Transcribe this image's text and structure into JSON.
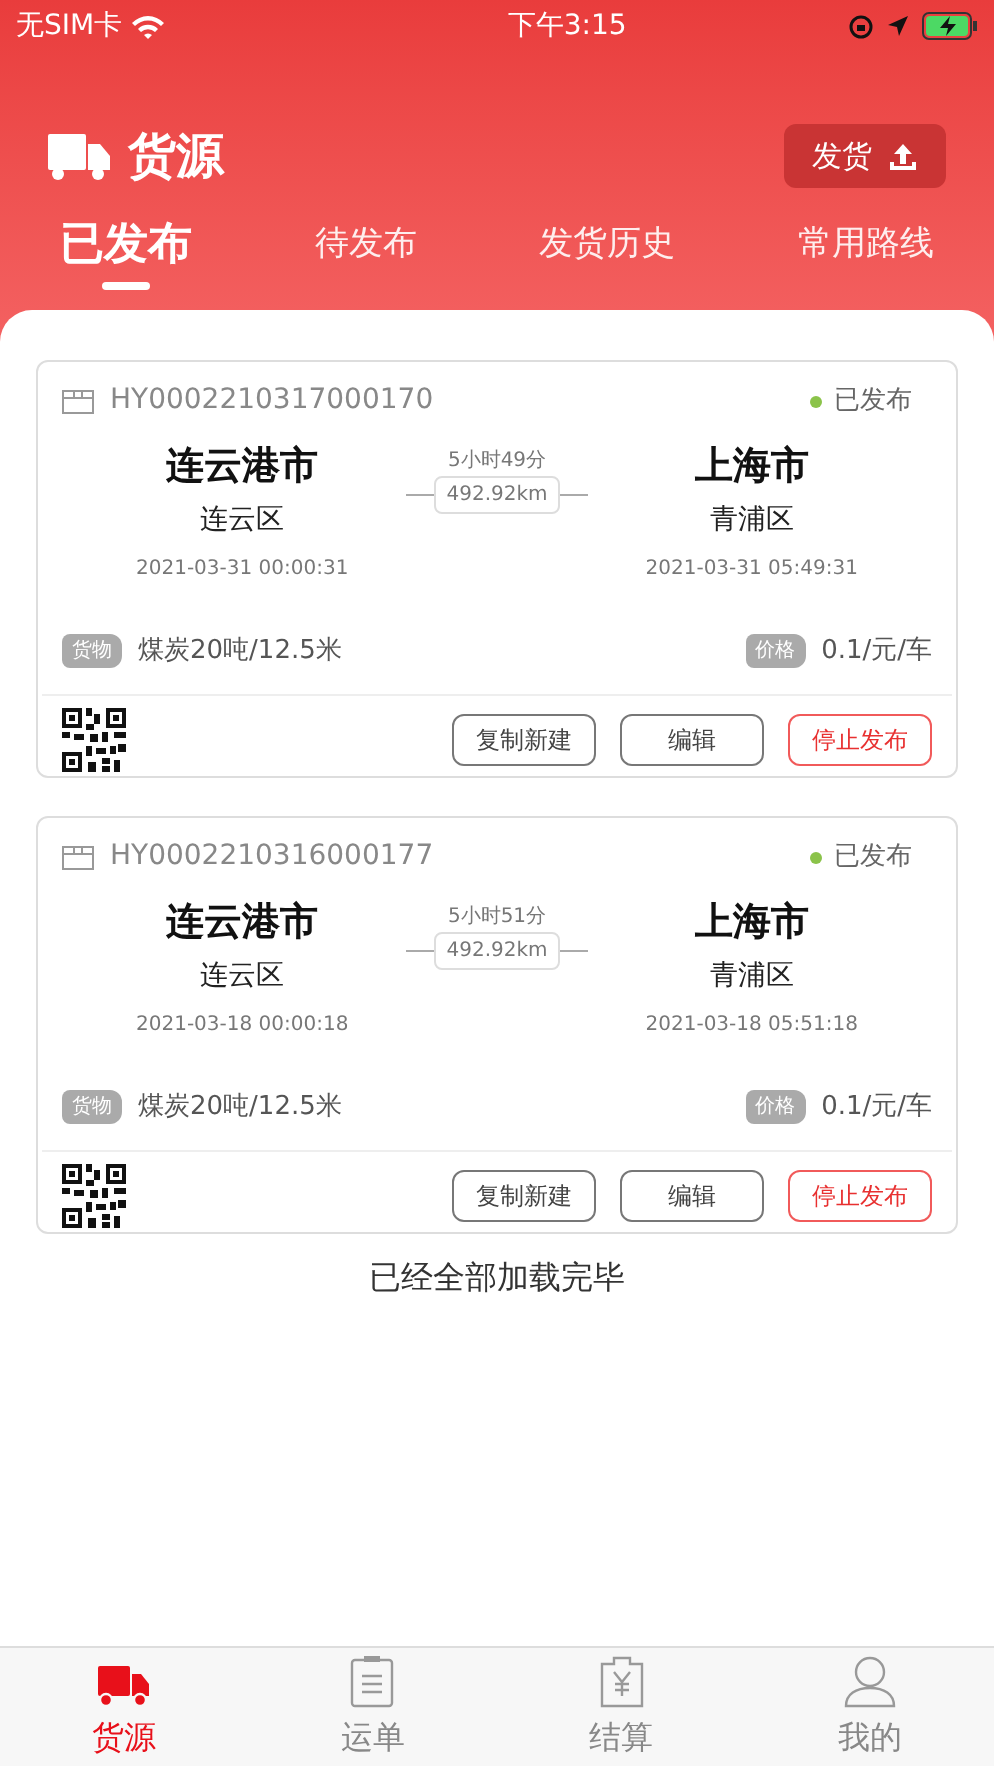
{
  "status_bar": {
    "carrier": "无SIM卡",
    "time": "下午3:15"
  },
  "header": {
    "title": "货源",
    "action_button": "发货"
  },
  "tabs": [
    {
      "label": "已发布",
      "selected": true
    },
    {
      "label": "待发布",
      "selected": false
    },
    {
      "label": "发货历史",
      "selected": false
    },
    {
      "label": "常用路线",
      "selected": false
    }
  ],
  "orders": [
    {
      "id": "HY0002210317000170",
      "status": "已发布",
      "color": "#8bc34a",
      "from": {
        "city": "连云港市",
        "district": "连云区",
        "time": "2021-03-31 00:00:31"
      },
      "to": {
        "city": "上海市",
        "district": "青浦区",
        "time": "2021-03-31 05:49:31"
      },
      "duration": "5小时49分",
      "distance": "492.92km",
      "goods_tag": "货物",
      "goods": "煤炭20吨/12.5米",
      "price_tag": "价格",
      "price": "0.1/元/车",
      "buttons": [
        {
          "label": "复制新建",
          "kind": "plain"
        },
        {
          "label": "编辑",
          "kind": "plain"
        },
        {
          "label": "停止发布",
          "kind": "danger"
        }
      ]
    },
    {
      "id": "HY0002210316000177",
      "status": "已发布",
      "color": "#8bc34a",
      "from": {
        "city": "连云港市",
        "district": "连云区",
        "time": "2021-03-18 00:00:18"
      },
      "to": {
        "city": "上海市",
        "district": "青浦区",
        "time": "2021-03-18 05:51:18"
      },
      "duration": "5小时51分",
      "distance": "492.92km",
      "goods_tag": "货物",
      "goods": "煤炭20吨/12.5米",
      "price_tag": "价格",
      "price": "0.1/元/车",
      "buttons": [
        {
          "label": "复制新建",
          "kind": "plain"
        },
        {
          "label": "编辑",
          "kind": "plain"
        },
        {
          "label": "停止发布",
          "kind": "danger"
        }
      ]
    }
  ],
  "end_message": "已经全部加载完毕",
  "bottom_tabs": [
    {
      "label": "货源",
      "kind": "truck",
      "selected": true
    },
    {
      "label": "运单",
      "kind": "clipboard",
      "selected": false
    },
    {
      "label": "结算",
      "kind": "bill",
      "selected": false
    },
    {
      "label": "我的",
      "kind": "person",
      "selected": false
    }
  ]
}
